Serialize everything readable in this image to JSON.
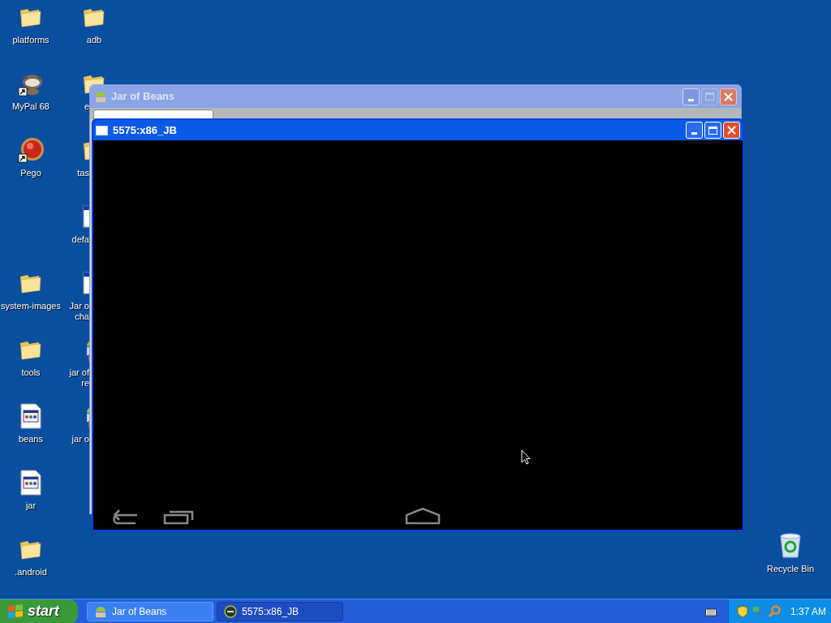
{
  "desktop_icons": [
    {
      "kind": "folder",
      "lines": [
        "platforms"
      ]
    },
    {
      "kind": "folder",
      "lines": [
        "adb"
      ]
    },
    {
      "kind": "animal",
      "lines": [
        "MyPal 68"
      ]
    },
    {
      "kind": "folder",
      "lines": [
        "e"
      ]
    },
    {
      "kind": "ball",
      "lines": [
        "Pego"
      ]
    },
    {
      "kind": "folder",
      "lines": [
        "tas"
      ]
    },
    {
      "kind": "window",
      "lines": [
        "defa"
      ]
    },
    {
      "kind": "folder",
      "lines": [
        "system-images"
      ]
    },
    {
      "kind": "window",
      "lines": [
        "Jar o",
        "cha"
      ]
    },
    {
      "kind": "folder",
      "lines": [
        "tools"
      ]
    },
    {
      "kind": "robot",
      "lines": [
        "jar of",
        "re"
      ]
    },
    {
      "kind": "document",
      "lines": [
        "beans"
      ]
    },
    {
      "kind": "robot",
      "lines": [
        "jar o"
      ]
    },
    {
      "kind": "document",
      "lines": [
        "jar"
      ]
    },
    {
      "kind": "folder",
      "lines": [
        ".android"
      ]
    },
    {
      "kind": "recycle",
      "lines": [
        "Recycle Bin"
      ]
    }
  ],
  "windows": [
    {
      "title": "Jar of Beans",
      "active": false
    },
    {
      "title": "5575:x86_JB",
      "active": true
    }
  ],
  "taskbar": {
    "start": "start",
    "buttons": [
      {
        "label": "Jar of Beans",
        "selected": false
      },
      {
        "label": "5575:x86_JB",
        "selected": true
      }
    ],
    "clock": "1:37 AM"
  }
}
